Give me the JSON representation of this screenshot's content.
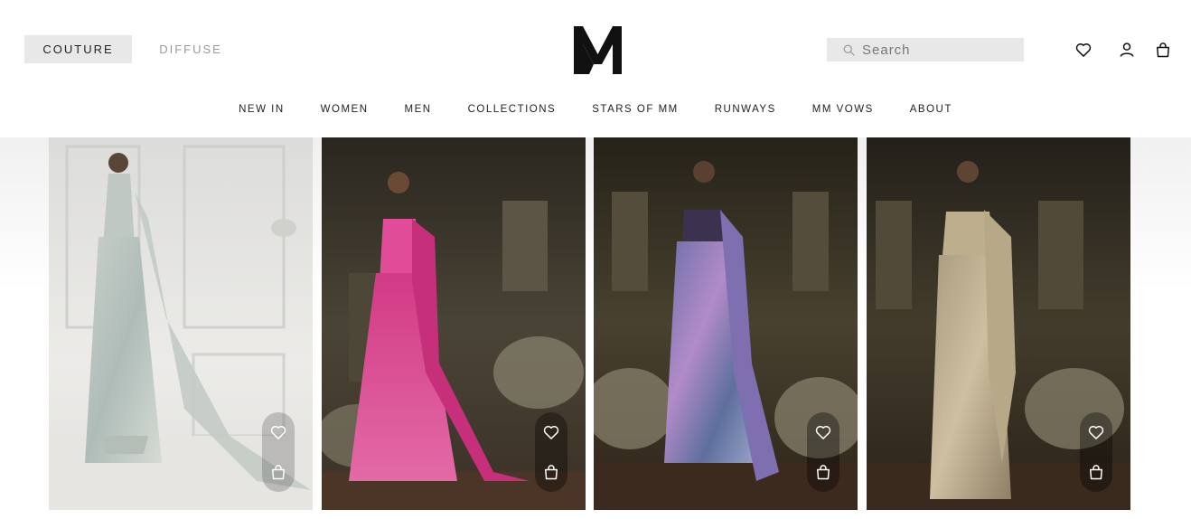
{
  "header": {
    "brand_tabs": [
      {
        "label": "COUTURE",
        "active": true
      },
      {
        "label": "DIFFUSE",
        "active": false
      }
    ],
    "logo_text": "M",
    "search": {
      "placeholder": "Search"
    },
    "icons": [
      "heart-icon",
      "user-icon",
      "bag-icon"
    ]
  },
  "nav": {
    "items": [
      "NEW IN",
      "WOMEN",
      "MEN",
      "COLLECTIONS",
      "STARS OF MM",
      "RUNWAYS",
      "MM VOWS",
      "ABOUT"
    ]
  },
  "products": [
    {
      "theme": "silver-sage saree, white studio",
      "actions": [
        "heart-icon",
        "bag-icon"
      ]
    },
    {
      "theme": "pink embellished lehenga saree, garden",
      "actions": [
        "heart-icon",
        "bag-icon"
      ]
    },
    {
      "theme": "iridescent sequin saree, garden",
      "actions": [
        "heart-icon",
        "bag-icon"
      ]
    },
    {
      "theme": "gold sequin saree, garden",
      "actions": [
        "heart-icon",
        "bag-icon"
      ]
    }
  ],
  "colors": {
    "accent_bg": "#e8e8e8",
    "text": "#111111",
    "muted": "#9a9a9a"
  }
}
